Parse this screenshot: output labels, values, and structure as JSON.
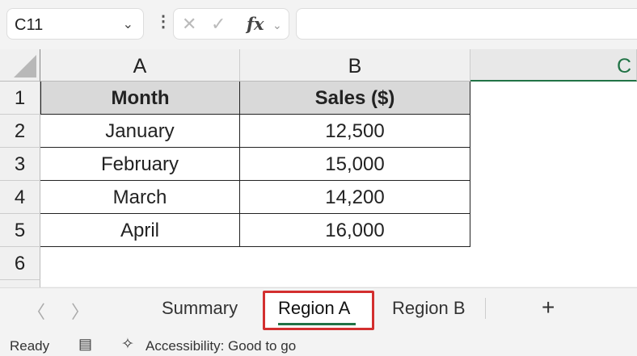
{
  "formula_bar": {
    "name_box": "C11",
    "formula": ""
  },
  "columns": [
    "A",
    "B",
    "C"
  ],
  "rows": [
    "1",
    "2",
    "3",
    "4",
    "5",
    "6"
  ],
  "table": {
    "headers": [
      "Month",
      "Sales ($)"
    ],
    "rows": [
      [
        "January",
        "12,500"
      ],
      [
        "February",
        "15,000"
      ],
      [
        "March",
        "14,200"
      ],
      [
        "April",
        "16,000"
      ]
    ]
  },
  "sheet_tabs": {
    "tabs": [
      "Summary",
      "Region A",
      "Region B"
    ],
    "active": "Region A",
    "add": "+"
  },
  "status_bar": {
    "ready": "Ready",
    "accessibility": "Accessibility: Good to go"
  },
  "colors": {
    "accent": "#217346",
    "highlight": "#d32f2f"
  }
}
